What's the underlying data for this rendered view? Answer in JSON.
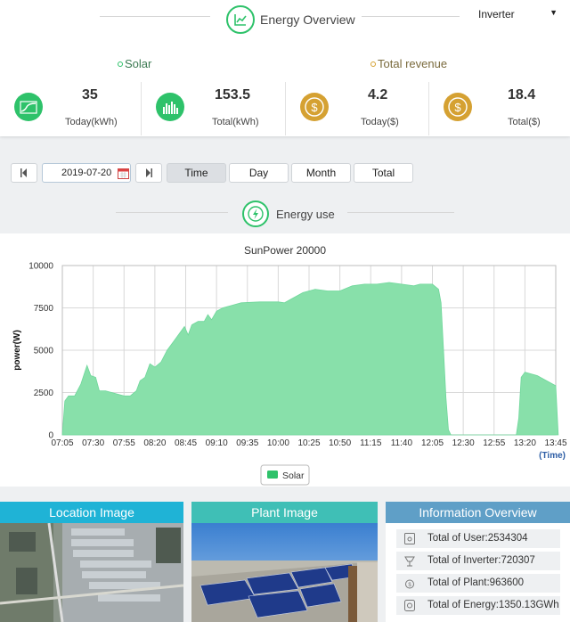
{
  "overview": {
    "title": "Energy Overview",
    "device_select": {
      "value": "Inverter",
      "arrow": "▼"
    },
    "solar": {
      "label": "Solar",
      "today": {
        "value": "35",
        "unit": "Today(kWh)"
      },
      "total": {
        "value": "153.5",
        "unit": "Total(kWh)"
      }
    },
    "revenue": {
      "label": "Total revenue",
      "today": {
        "value": "4.2",
        "unit": "Today($)"
      },
      "total": {
        "value": "18.4",
        "unit": "Total($)"
      }
    }
  },
  "toolbar": {
    "date": "2019-07-20",
    "periods": [
      {
        "label": "Time",
        "active": true
      },
      {
        "label": "Day",
        "active": false
      },
      {
        "label": "Month",
        "active": false
      },
      {
        "label": "Total",
        "active": false
      }
    ]
  },
  "energy_use": {
    "title": "Energy use"
  },
  "chart_data": {
    "type": "area",
    "title": "SunPower 20000",
    "ylabel": "power(W)",
    "xlabel": "(Time)",
    "ylim": [
      0,
      10000
    ],
    "yticks": [
      0,
      2500,
      5000,
      7500,
      10000
    ],
    "xticks": [
      "07:05",
      "07:30",
      "07:55",
      "08:20",
      "08:45",
      "09:10",
      "09:35",
      "10:00",
      "10:25",
      "10:50",
      "11:15",
      "11:40",
      "12:05",
      "12:30",
      "12:55",
      "13:20",
      "13:45"
    ],
    "grid": true,
    "legend": "bottom",
    "color": "#88e0aa",
    "series": [
      {
        "name": "Solar",
        "points": [
          [
            "07:05",
            0
          ],
          [
            "07:07",
            2000
          ],
          [
            "07:10",
            2300
          ],
          [
            "07:15",
            2300
          ],
          [
            "07:20",
            3000
          ],
          [
            "07:25",
            4100
          ],
          [
            "07:28",
            3500
          ],
          [
            "07:32",
            3400
          ],
          [
            "07:35",
            2600
          ],
          [
            "07:40",
            2600
          ],
          [
            "07:45",
            2500
          ],
          [
            "07:50",
            2400
          ],
          [
            "07:55",
            2300
          ],
          [
            "08:00",
            2300
          ],
          [
            "08:05",
            2600
          ],
          [
            "08:08",
            3200
          ],
          [
            "08:12",
            3400
          ],
          [
            "08:16",
            4200
          ],
          [
            "08:20",
            4000
          ],
          [
            "08:25",
            4300
          ],
          [
            "08:30",
            5000
          ],
          [
            "08:35",
            5500
          ],
          [
            "08:40",
            6000
          ],
          [
            "08:44",
            6400
          ],
          [
            "08:47",
            5900
          ],
          [
            "08:50",
            6500
          ],
          [
            "08:55",
            6700
          ],
          [
            "09:00",
            6700
          ],
          [
            "09:03",
            7100
          ],
          [
            "09:06",
            6800
          ],
          [
            "09:10",
            7300
          ],
          [
            "09:15",
            7500
          ],
          [
            "09:20",
            7600
          ],
          [
            "09:30",
            7800
          ],
          [
            "09:45",
            7850
          ],
          [
            "10:00",
            7850
          ],
          [
            "10:05",
            7800
          ],
          [
            "10:10",
            8000
          ],
          [
            "10:20",
            8400
          ],
          [
            "10:30",
            8600
          ],
          [
            "10:40",
            8500
          ],
          [
            "10:50",
            8500
          ],
          [
            "11:00",
            8800
          ],
          [
            "11:10",
            8900
          ],
          [
            "11:20",
            8900
          ],
          [
            "11:30",
            9000
          ],
          [
            "11:40",
            8900
          ],
          [
            "11:50",
            8800
          ],
          [
            "11:55",
            8900
          ],
          [
            "12:05",
            8900
          ],
          [
            "12:10",
            8600
          ],
          [
            "12:12",
            7800
          ],
          [
            "12:14",
            5000
          ],
          [
            "12:16",
            2200
          ],
          [
            "12:18",
            300
          ],
          [
            "12:20",
            0
          ],
          [
            "13:13",
            0
          ],
          [
            "13:15",
            1000
          ],
          [
            "13:17",
            3400
          ],
          [
            "13:20",
            3700
          ],
          [
            "13:30",
            3500
          ],
          [
            "13:40",
            3100
          ],
          [
            "13:45",
            2900
          ],
          [
            "13:47",
            0
          ]
        ]
      }
    ]
  },
  "panels": {
    "location": {
      "title": "Location Image"
    },
    "plant": {
      "title": "Plant Image"
    },
    "info": {
      "title": "Information Overview",
      "items": [
        {
          "icon": "user-icon",
          "text": "Total of User:2534304"
        },
        {
          "icon": "inverter-icon",
          "text": "Total of Inverter:720307"
        },
        {
          "icon": "plant-icon",
          "text": "Total of Plant:963600"
        },
        {
          "icon": "energy-icon",
          "text": "Total of Energy:1350.13GWh"
        }
      ]
    }
  }
}
